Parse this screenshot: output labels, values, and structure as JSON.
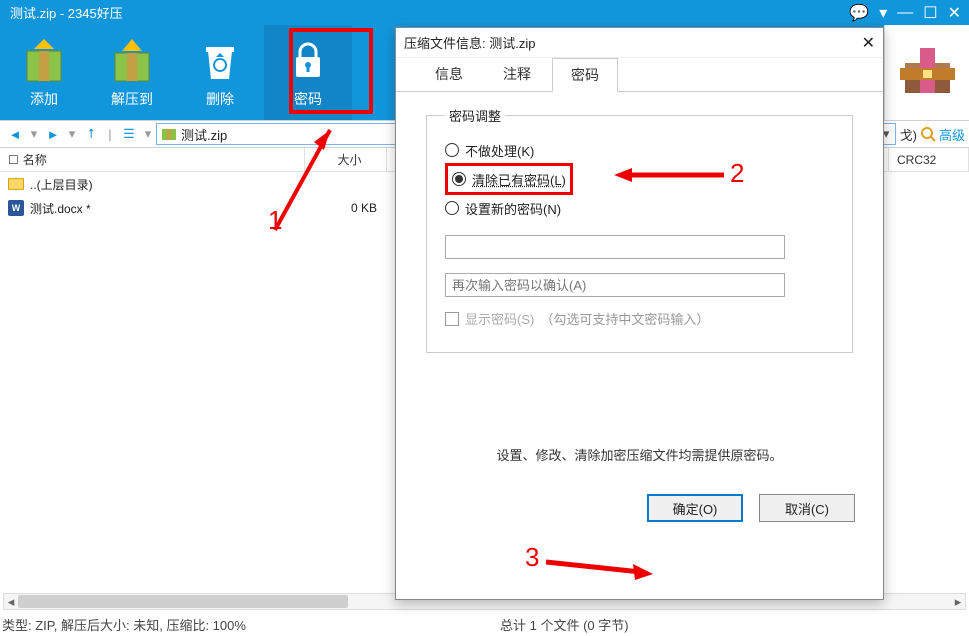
{
  "title": "测试.zip - 2345好压",
  "toolbar": {
    "add": "添加",
    "extract": "解压到",
    "delete": "删除",
    "password": "密码"
  },
  "pathbar": {
    "filename": "测试.zip",
    "right_hint": "戈)",
    "adv": "高级"
  },
  "columns": {
    "name": "名称",
    "size": "大小",
    "crc": "CRC32"
  },
  "rows": [
    {
      "name": "..(上层目录)",
      "size": ""
    },
    {
      "name": "测试.docx *",
      "size": "0 KB"
    }
  ],
  "status": {
    "left": "类型: ZIP, 解压后大小: 未知, 压缩比: 100%",
    "right": "总计 1 个文件 (0 字节)"
  },
  "dialog": {
    "title": "压缩文件信息: 测试.zip",
    "tabs": {
      "info": "信息",
      "comment": "注释",
      "password": "密码"
    },
    "fieldset": "密码调整",
    "radio_keep": "不做处理(K)",
    "radio_clear": "清除已有密码(L)",
    "radio_set": "设置新的密码(N)",
    "placeholder_confirm": "再次输入密码以确认(A)",
    "cb_show": "显示密码(S)",
    "cb_hint": "（勾选可支持中文密码输入）",
    "note": "设置、修改、清除加密压缩文件均需提供原密码。",
    "ok": "确定(O)",
    "cancel": "取消(C)"
  },
  "anno": {
    "n1": "1",
    "n2": "2",
    "n3": "3"
  }
}
